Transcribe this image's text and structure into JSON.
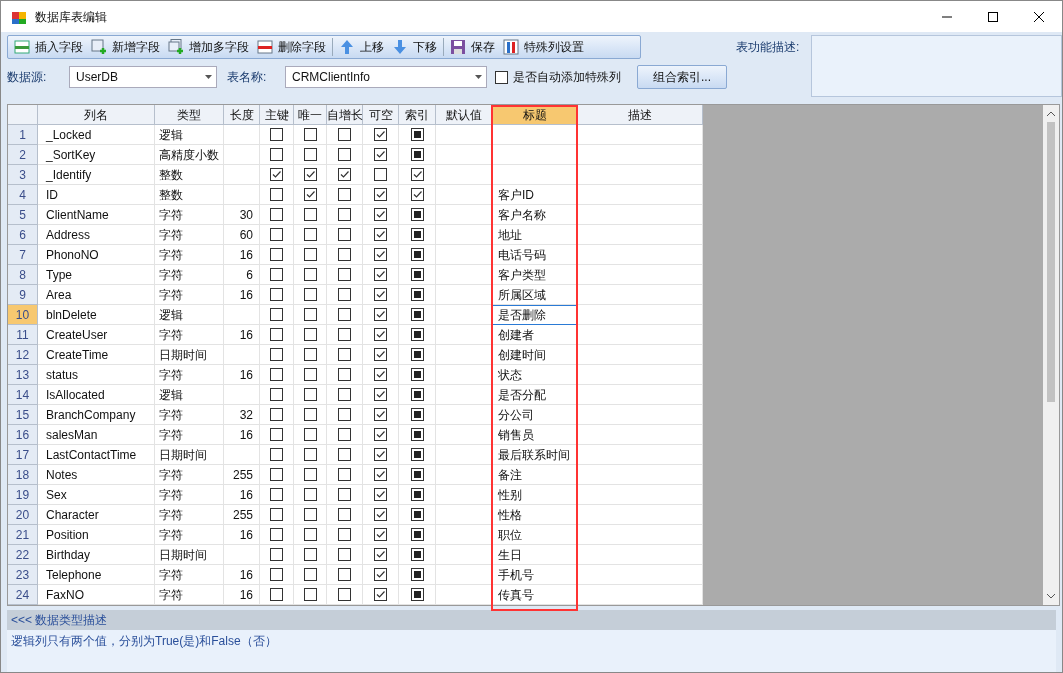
{
  "window": {
    "title": "数据库表编辑"
  },
  "toolbar": [
    {
      "label": "插入字段",
      "kind": "insert"
    },
    {
      "label": "新增字段",
      "kind": "add"
    },
    {
      "label": "增加多字段",
      "kind": "addmulti"
    },
    {
      "label": "删除字段",
      "kind": "delete"
    },
    {
      "label": "上移",
      "kind": "up"
    },
    {
      "label": "下移",
      "kind": "down"
    },
    {
      "label": "保存",
      "kind": "save"
    },
    {
      "label": "特殊列设置",
      "kind": "special"
    }
  ],
  "description": {
    "label": "表功能描述:"
  },
  "datasource": {
    "label": "数据源:",
    "value": "UserDB"
  },
  "table_name": {
    "label": "表名称:",
    "value": "CRMClientInfo"
  },
  "auto_special": {
    "label": "是否自动添加特殊列",
    "checked": false
  },
  "index_button": "组合索引...",
  "columns": [
    {
      "label": "列名",
      "selected": false
    },
    {
      "label": "类型",
      "selected": false
    },
    {
      "label": "长度",
      "selected": false
    },
    {
      "label": "主键",
      "selected": false
    },
    {
      "label": "唯一",
      "selected": false
    },
    {
      "label": "自增长",
      "selected": false
    },
    {
      "label": "可空",
      "selected": false
    },
    {
      "label": "索引",
      "selected": false
    },
    {
      "label": "默认值",
      "selected": false
    },
    {
      "label": "标题",
      "selected": true
    },
    {
      "label": "描述",
      "selected": false
    }
  ],
  "rows": [
    {
      "num": "1",
      "name": "_Locked",
      "type": "逻辑",
      "length": "",
      "pk": false,
      "unique": false,
      "auto": false,
      "nullable": true,
      "index_checked": false,
      "index_partial": true,
      "title": "",
      "selected": false
    },
    {
      "num": "2",
      "name": "_SortKey",
      "type": "高精度小数",
      "length": "",
      "pk": false,
      "unique": false,
      "auto": false,
      "nullable": true,
      "index_checked": false,
      "index_partial": true,
      "title": "",
      "selected": false
    },
    {
      "num": "3",
      "name": "_Identify",
      "type": "整数",
      "length": "",
      "pk": true,
      "unique": true,
      "auto": true,
      "nullable": false,
      "index_checked": true,
      "index_partial": false,
      "title": "",
      "selected": false
    },
    {
      "num": "4",
      "name": "ID",
      "type": "整数",
      "length": "",
      "pk": false,
      "unique": true,
      "auto": false,
      "nullable": true,
      "index_checked": true,
      "index_partial": false,
      "title": "客户ID",
      "selected": false
    },
    {
      "num": "5",
      "name": "ClientName",
      "type": "字符",
      "length": "30",
      "pk": false,
      "unique": false,
      "auto": false,
      "nullable": true,
      "index_checked": false,
      "index_partial": true,
      "title": "客户名称",
      "selected": false
    },
    {
      "num": "6",
      "name": "Address",
      "type": "字符",
      "length": "60",
      "pk": false,
      "unique": false,
      "auto": false,
      "nullable": true,
      "index_checked": false,
      "index_partial": true,
      "title": "地址",
      "selected": false
    },
    {
      "num": "7",
      "name": "PhonoNO",
      "type": "字符",
      "length": "16",
      "pk": false,
      "unique": false,
      "auto": false,
      "nullable": true,
      "index_checked": false,
      "index_partial": true,
      "title": "电话号码",
      "selected": false
    },
    {
      "num": "8",
      "name": "Type",
      "type": "字符",
      "length": "6",
      "pk": false,
      "unique": false,
      "auto": false,
      "nullable": true,
      "index_checked": false,
      "index_partial": true,
      "title": "客户类型",
      "selected": false
    },
    {
      "num": "9",
      "name": "Area",
      "type": "字符",
      "length": "16",
      "pk": false,
      "unique": false,
      "auto": false,
      "nullable": true,
      "index_checked": false,
      "index_partial": true,
      "title": "所属区域",
      "selected": false
    },
    {
      "num": "10",
      "name": "blnDelete",
      "type": "逻辑",
      "length": "",
      "pk": false,
      "unique": false,
      "auto": false,
      "nullable": true,
      "index_checked": false,
      "index_partial": true,
      "title": "是否删除",
      "selected": true
    },
    {
      "num": "11",
      "name": "CreateUser",
      "type": "字符",
      "length": "16",
      "pk": false,
      "unique": false,
      "auto": false,
      "nullable": true,
      "index_checked": false,
      "index_partial": true,
      "title": "创建者",
      "selected": false
    },
    {
      "num": "12",
      "name": "CreateTime",
      "type": "日期时间",
      "length": "",
      "pk": false,
      "unique": false,
      "auto": false,
      "nullable": true,
      "index_checked": false,
      "index_partial": true,
      "title": "创建时间",
      "selected": false
    },
    {
      "num": "13",
      "name": "status",
      "type": "字符",
      "length": "16",
      "pk": false,
      "unique": false,
      "auto": false,
      "nullable": true,
      "index_checked": false,
      "index_partial": true,
      "title": "状态",
      "selected": false
    },
    {
      "num": "14",
      "name": "IsAllocated",
      "type": "逻辑",
      "length": "",
      "pk": false,
      "unique": false,
      "auto": false,
      "nullable": true,
      "index_checked": false,
      "index_partial": true,
      "title": "是否分配",
      "selected": false
    },
    {
      "num": "15",
      "name": "BranchCompany",
      "type": "字符",
      "length": "32",
      "pk": false,
      "unique": false,
      "auto": false,
      "nullable": true,
      "index_checked": false,
      "index_partial": true,
      "title": "分公司",
      "selected": false
    },
    {
      "num": "16",
      "name": "salesMan",
      "type": "字符",
      "length": "16",
      "pk": false,
      "unique": false,
      "auto": false,
      "nullable": true,
      "index_checked": false,
      "index_partial": true,
      "title": "销售员",
      "selected": false
    },
    {
      "num": "17",
      "name": "LastContactTime",
      "type": "日期时间",
      "length": "",
      "pk": false,
      "unique": false,
      "auto": false,
      "nullable": true,
      "index_checked": false,
      "index_partial": true,
      "title": "最后联系时间",
      "selected": false
    },
    {
      "num": "18",
      "name": "Notes",
      "type": "字符",
      "length": "255",
      "pk": false,
      "unique": false,
      "auto": false,
      "nullable": true,
      "index_checked": false,
      "index_partial": true,
      "title": "备注",
      "selected": false
    },
    {
      "num": "19",
      "name": "Sex",
      "type": "字符",
      "length": "16",
      "pk": false,
      "unique": false,
      "auto": false,
      "nullable": true,
      "index_checked": false,
      "index_partial": true,
      "title": "性别",
      "selected": false
    },
    {
      "num": "20",
      "name": "Character",
      "type": "字符",
      "length": "255",
      "pk": false,
      "unique": false,
      "auto": false,
      "nullable": true,
      "index_checked": false,
      "index_partial": true,
      "title": "性格",
      "selected": false
    },
    {
      "num": "21",
      "name": "Position",
      "type": "字符",
      "length": "16",
      "pk": false,
      "unique": false,
      "auto": false,
      "nullable": true,
      "index_checked": false,
      "index_partial": true,
      "title": "职位",
      "selected": false
    },
    {
      "num": "22",
      "name": "Birthday",
      "type": "日期时间",
      "length": "",
      "pk": false,
      "unique": false,
      "auto": false,
      "nullable": true,
      "index_checked": false,
      "index_partial": true,
      "title": "生日",
      "selected": false
    },
    {
      "num": "23",
      "name": "Telephone",
      "type": "字符",
      "length": "16",
      "pk": false,
      "unique": false,
      "auto": false,
      "nullable": true,
      "index_checked": false,
      "index_partial": true,
      "title": "手机号",
      "selected": false
    },
    {
      "num": "24",
      "name": "FaxNO",
      "type": "字符",
      "length": "16",
      "pk": false,
      "unique": false,
      "auto": false,
      "nullable": true,
      "index_checked": false,
      "index_partial": true,
      "title": "传真号",
      "selected": false
    }
  ],
  "info_panel": {
    "header": "<<< 数据类型描述",
    "text": "逻辑列只有两个值，分别为True(是)和False（否）"
  }
}
